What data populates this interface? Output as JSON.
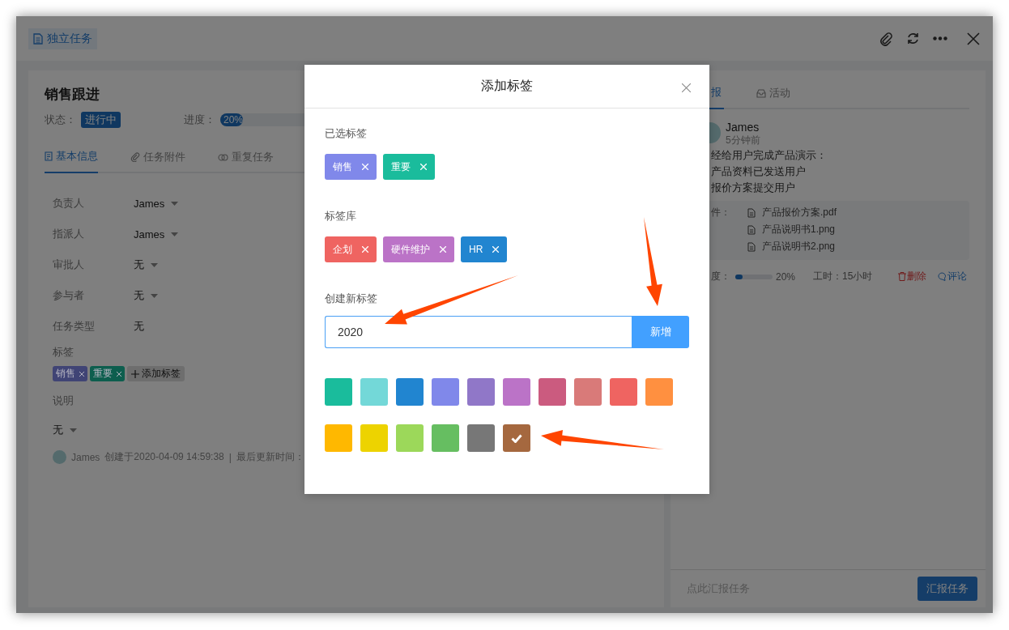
{
  "window": {
    "tab_label": "独立任务"
  },
  "task": {
    "title": "销售跟进",
    "status_label": "状态：",
    "status": "进行中",
    "progress_label": "进度：",
    "progress": {
      "level": 0.2,
      "reading": "20%"
    },
    "tabs": [
      {
        "label": "基本信息",
        "selected": true
      },
      {
        "label": "任务附件",
        "selected": false
      },
      {
        "label": "重复任务",
        "selected": false
      }
    ],
    "fields": [
      {
        "label": "负责人",
        "value": "James",
        "dropdown": true
      },
      {
        "label": "指派人",
        "value": "James",
        "dropdown": true
      },
      {
        "label": "审批人",
        "value": "无",
        "dropdown": true
      },
      {
        "label": "参与者",
        "value": "无",
        "dropdown": true
      },
      {
        "label": "任务类型",
        "value": "无",
        "dropdown": false
      }
    ],
    "tags_label": "标签",
    "tags": [
      {
        "label": "销售",
        "color": "#404475"
      },
      {
        "label": "重要",
        "color": "#0d5e4e"
      }
    ],
    "add_tag": "添加标签",
    "description_label": "说明",
    "description": "无",
    "footer": {
      "author": "James",
      "created": "创建于2020-04-09 14:59:38",
      "separator": "|",
      "updated_label": "最后更新时间："
    }
  },
  "report_panel": {
    "tabs": [
      {
        "label": "报",
        "selected": true
      },
      {
        "label": "活动",
        "selected": false
      }
    ],
    "author": "James",
    "time": "5分钟前",
    "lines": [
      "经给用户完成产品演示：",
      "产品资料已发送用户",
      "报价方案提交用户"
    ],
    "attachments_label": "件：",
    "attachments": [
      "产品报价方案.pdf",
      "产品说明书1.png",
      "产品说明书2.png"
    ],
    "progress_label": "度：",
    "progress": {
      "level": 0.2,
      "reading": "20%"
    },
    "hours": "工时：15小时",
    "delete": "删除",
    "comment": "评论",
    "placeholder": "点此汇报任务",
    "submit": "汇报任务"
  },
  "modal": {
    "title": "添加标签",
    "selected_label": "已选标签",
    "selected_tags": [
      {
        "label": "销售",
        "color": "#8088ea"
      },
      {
        "label": "重要",
        "color": "#1abc9c"
      }
    ],
    "library_label": "标签库",
    "library_tags": [
      {
        "label": "企划",
        "color": "#ef6461"
      },
      {
        "label": "硬件维护",
        "color": "#bb73c7"
      },
      {
        "label": "HR",
        "color": "#2185d0"
      }
    ],
    "create_label": "创建新标签",
    "input_value": "2020",
    "add_button": "新增",
    "swatches": [
      {
        "color": "#1abc9c",
        "selected": false
      },
      {
        "color": "#73d8d8",
        "selected": false
      },
      {
        "color": "#2185d0",
        "selected": false
      },
      {
        "color": "#8088ea",
        "selected": false
      },
      {
        "color": "#9077c8",
        "selected": false
      },
      {
        "color": "#bb73c7",
        "selected": false
      },
      {
        "color": "#cb5b7f",
        "selected": false
      },
      {
        "color": "#d97a79",
        "selected": false
      },
      {
        "color": "#ef6461",
        "selected": false
      },
      {
        "color": "#ff9040",
        "selected": false
      },
      {
        "color": "#ffb800",
        "selected": false
      },
      {
        "color": "#edd300",
        "selected": false
      },
      {
        "color": "#9cd85a",
        "selected": false
      },
      {
        "color": "#66be61",
        "selected": false
      },
      {
        "color": "#777777",
        "selected": false
      },
      {
        "color": "#a5683f",
        "selected": true
      }
    ]
  }
}
